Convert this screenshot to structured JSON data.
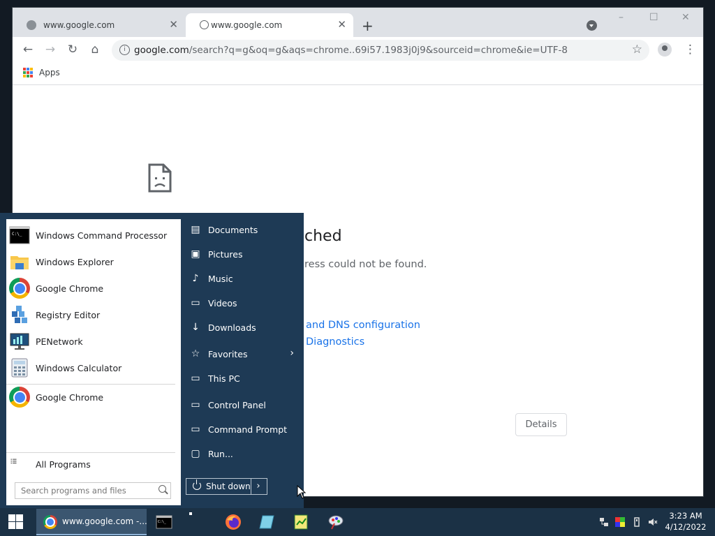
{
  "browser": {
    "tabs": [
      {
        "title": "www.google.com",
        "active": false
      },
      {
        "title": "www.google.com",
        "active": true
      }
    ],
    "new_tab_symbol": "+",
    "url_host": "google.com",
    "url_rest": "/search?q=g&oq=g&aqs=chrome..69i57.1983j0j9&sourceid=chrome&ie=UTF-8",
    "bookmarks_apps": "Apps",
    "window_controls": {
      "minimize": "–",
      "maximize": "☐",
      "close": "✕"
    }
  },
  "error_page": {
    "title": "ched",
    "description": "ress could not be found.",
    "link1": "and DNS configuration",
    "link2": "Diagnostics",
    "details_button": "Details"
  },
  "start_menu": {
    "programs": [
      {
        "label": "Windows Command Processor",
        "icon": "cmd-icon"
      },
      {
        "label": "Windows Explorer",
        "icon": "folder-icon"
      },
      {
        "label": "Google Chrome",
        "icon": "chrome-icon"
      },
      {
        "label": "Registry Editor",
        "icon": "registry-icon"
      },
      {
        "label": "PENetwork",
        "icon": "network-icon"
      },
      {
        "label": "Windows Calculator",
        "icon": "calculator-icon"
      },
      {
        "label": "Google Chrome",
        "icon": "chrome-icon"
      }
    ],
    "all_programs": "All Programs",
    "search_placeholder": "Search programs and files",
    "right_items": [
      {
        "label": "Documents",
        "icon": "documents-icon"
      },
      {
        "label": "Pictures",
        "icon": "pictures-icon"
      },
      {
        "label": "Music",
        "icon": "music-icon"
      },
      {
        "label": "Videos",
        "icon": "videos-icon"
      },
      {
        "label": "Downloads",
        "icon": "downloads-icon"
      },
      {
        "label": "Favorites",
        "icon": "star-icon"
      },
      {
        "label": "This PC",
        "icon": "computer-icon"
      },
      {
        "label": "Control Panel",
        "icon": "control-panel-icon"
      },
      {
        "label": "Command Prompt",
        "icon": "cmd-icon"
      },
      {
        "label": "Run...",
        "icon": "run-icon"
      }
    ],
    "shutdown_label": "Shut down"
  },
  "taskbar": {
    "active_task": "www.google.com -...",
    "time": "3:23 AM",
    "date": "4/12/2022"
  },
  "colors": {
    "desktop": "#121a23",
    "start_menu_right": "#1e3a55",
    "taskbar": "#1b3145",
    "link": "#1a73e8"
  }
}
